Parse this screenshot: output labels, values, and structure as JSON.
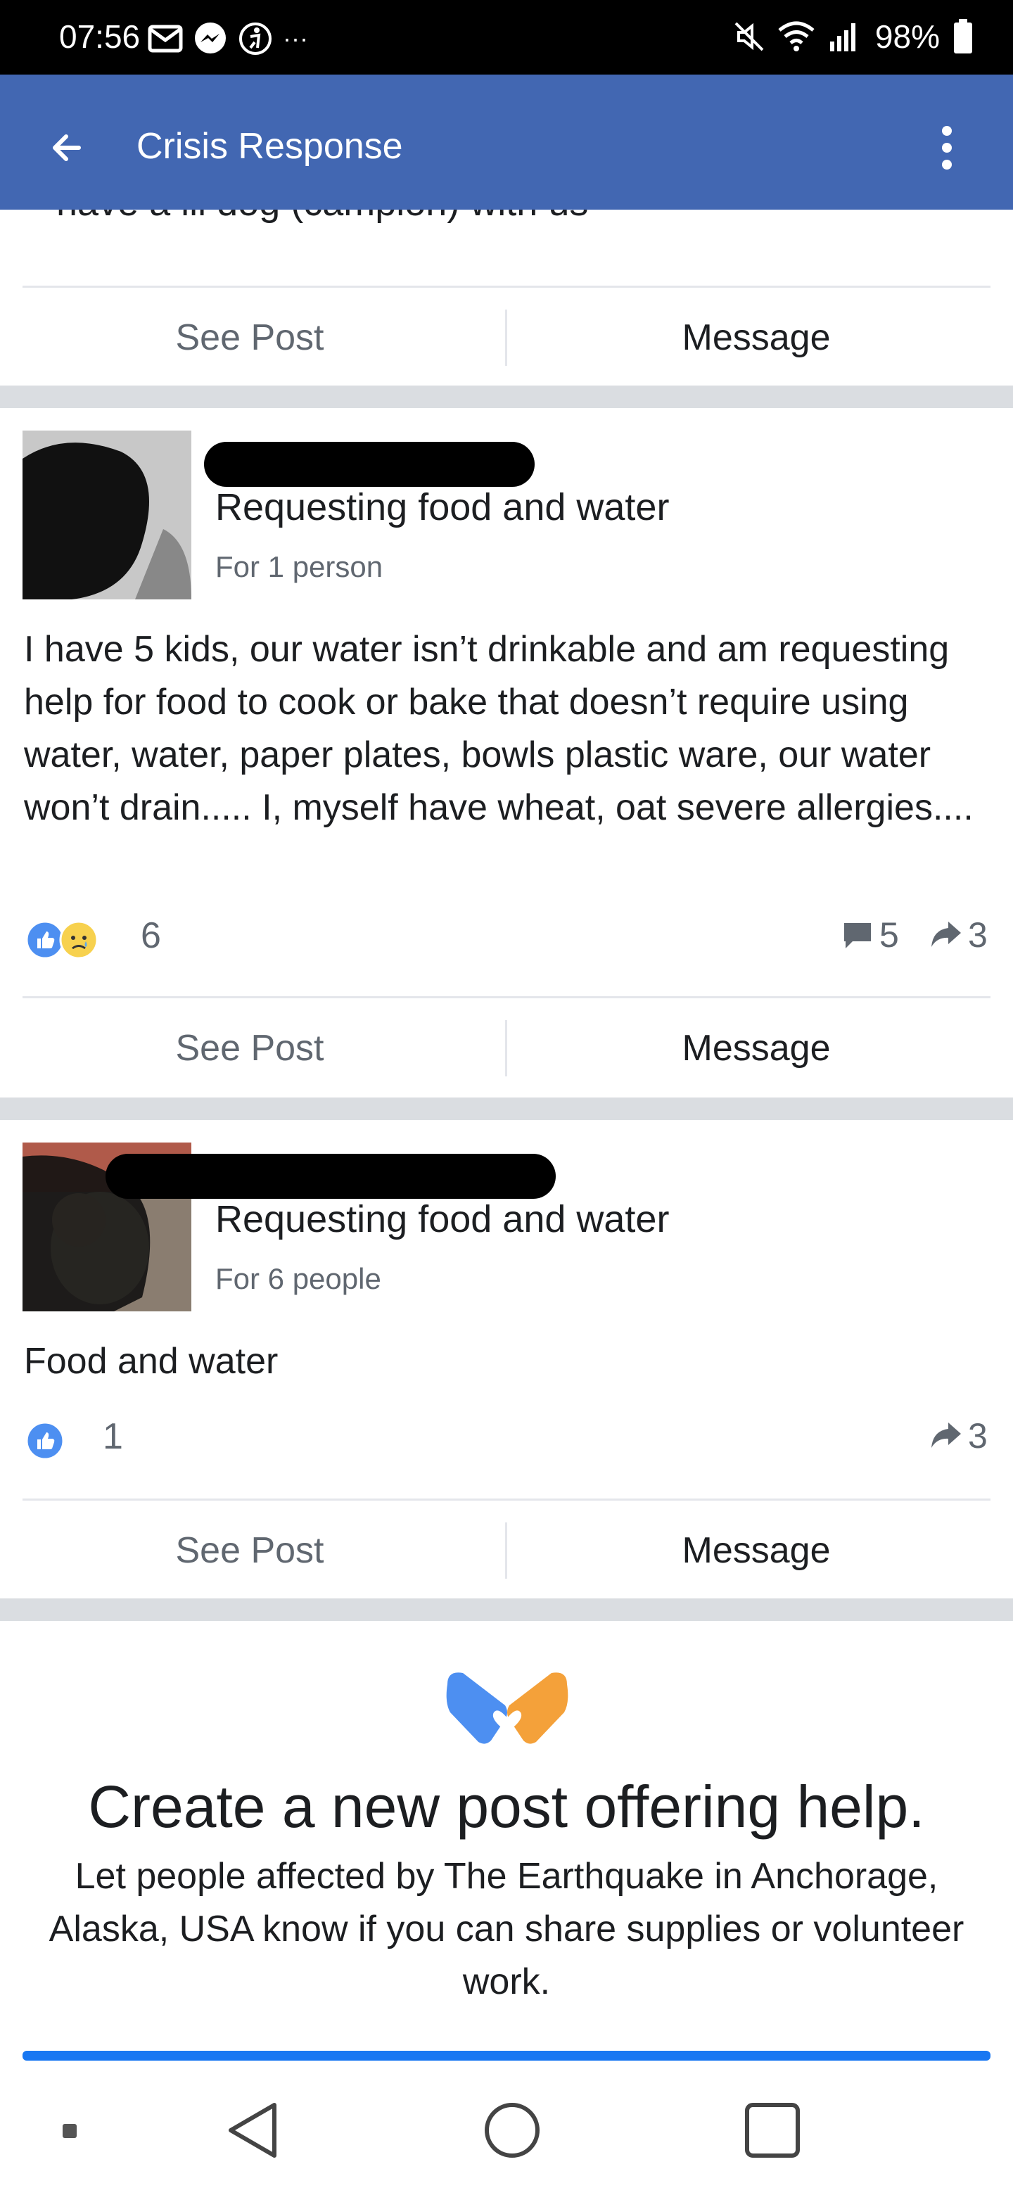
{
  "status_bar": {
    "time": "07:56",
    "more": "···",
    "battery": "98%"
  },
  "app_bar": {
    "title": "Crisis Response"
  },
  "cut_off_text": "have a lil dog (campion) with us",
  "post_actions": {
    "see_post": "See Post",
    "message": "Message"
  },
  "posts": [
    {
      "title": "Requesting food and water",
      "subtitle": "For 1 person",
      "body": "I have 5 kids, our water isn’t drinkable and am requesting help for food to cook or bake that doesn’t require using water, water, paper plates, bowls plastic ware, our water won’t drain..... I, myself have wheat, oat severe allergies....",
      "reactions_count": "6",
      "comments": "5",
      "shares": "3"
    },
    {
      "title": "Requesting food and water",
      "subtitle": "For 6 people",
      "body": "Food and water",
      "reactions_count": "1",
      "shares": "3"
    }
  ],
  "cta": {
    "title": "Create a new post offering help.",
    "body": "Let people affected by The Earthquake in Anchorage, Alaska, USA know if you can share supplies or volunteer work."
  },
  "colors": {
    "app_bar": "#4267b2",
    "like_blue": "#4d8ff1",
    "heart_orange": "#f4a13a"
  }
}
